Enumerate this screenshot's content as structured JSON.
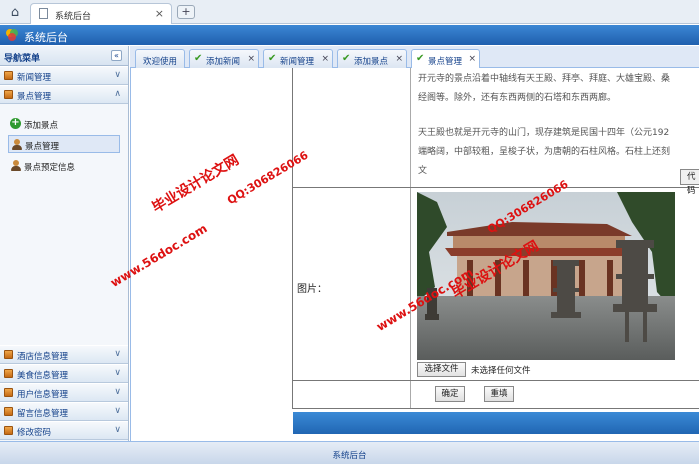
{
  "browser": {
    "tab_title": "系统后台",
    "tab_close": "×",
    "new_tab": "+"
  },
  "app": {
    "title": "系统后台",
    "accent": "#2a6fc0"
  },
  "sidebar": {
    "header": "导航菜单",
    "collapse": "«",
    "sections": [
      {
        "label": "新闻管理",
        "chevron": "∨"
      },
      {
        "label": "景点管理",
        "chevron": "∧"
      }
    ],
    "items": [
      {
        "label": "添加景点",
        "icon": "add-icon"
      },
      {
        "label": "景点管理",
        "icon": "user-icon"
      },
      {
        "label": "景点预定信息",
        "icon": "user-icon"
      }
    ],
    "bottom_sections": [
      {
        "label": "酒店信息管理",
        "chevron": "∨"
      },
      {
        "label": "美食信息管理",
        "chevron": "∨"
      },
      {
        "label": "用户信息管理",
        "chevron": "∨"
      },
      {
        "label": "留言信息管理",
        "chevron": "∨"
      },
      {
        "label": "修改密码",
        "chevron": "∨"
      }
    ]
  },
  "tabs": [
    {
      "label": "欢迎使用",
      "closable": false
    },
    {
      "label": "添加新闻",
      "closable": true
    },
    {
      "label": "新闻管理",
      "closable": true
    },
    {
      "label": "添加景点",
      "closable": true
    },
    {
      "label": "景点管理",
      "closable": true,
      "active": true
    }
  ],
  "tab_close": "×",
  "form": {
    "para1_line1": "开元寺的景点沿着中轴线有天王殿、拜亭、拜庭、大雄宝殿、桑",
    "para1_line2": "经阁等。除外，还有东西两侧的石塔和东西两廊。",
    "para2_line1": "天王殿也就是开元寺的山门，现存建筑是民国十四年（公元192",
    "para2_line2": "端略阔，中部较粗，呈梭子状，为唐朝的石柱风格。石柱上还刻",
    "para2_line3": "文",
    "code_button": "代码",
    "image_label": "图片：",
    "file_button": "选择文件",
    "file_status": "未选择任何文件",
    "confirm": "确定",
    "reset": "重填"
  },
  "watermarks": [
    "毕业设计论文网",
    "QQ:306826066",
    "www.56doc.com"
  ],
  "footer": {
    "text": "系统后台"
  }
}
